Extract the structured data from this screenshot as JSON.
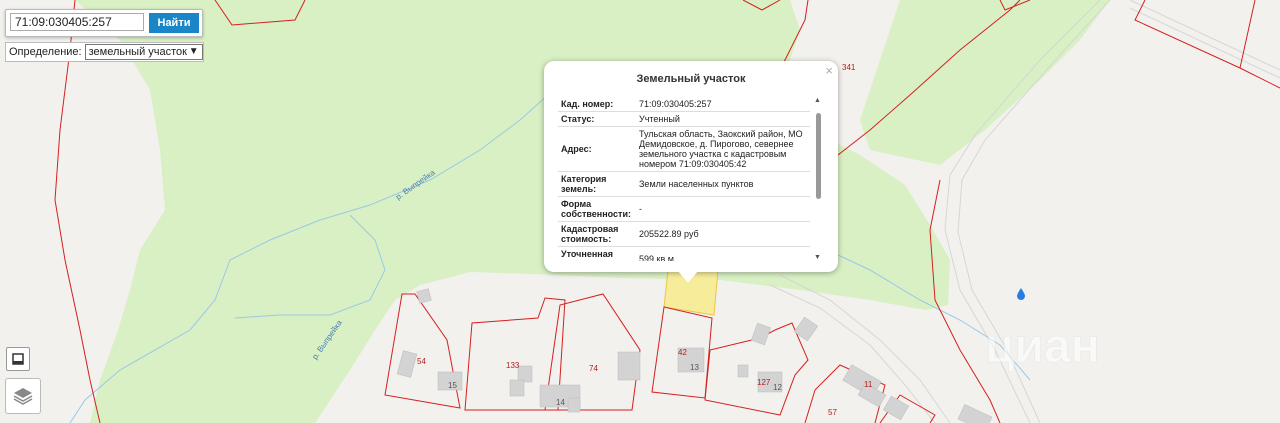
{
  "search": {
    "value": "71:09:030405:257",
    "button_label": "Найти"
  },
  "definition": {
    "label": "Определение:",
    "selected": "земельный участок"
  },
  "popup": {
    "title": "Земельный участок",
    "close_glyph": "×",
    "rows": [
      {
        "key": "Кад. номер:",
        "value": "71:09:030405:257"
      },
      {
        "key": "Статус:",
        "value": "Учтенный"
      },
      {
        "key": "Адрес:",
        "value": "Тульская область, Заокский район, МО Демидовское, д. Пирогово, севернее земельного участка с кадастровым номером 71:09:030405:42"
      },
      {
        "key": "Категория земель:",
        "value": "Земли населенных пунктов"
      },
      {
        "key": "Форма собственности:",
        "value": "-"
      },
      {
        "key": "Кадастровая стоимость:",
        "value": "205522.89 руб"
      },
      {
        "key": "Уточненная площадь:",
        "value": "599 кв.м"
      }
    ]
  },
  "map": {
    "river_label": "р. Выпрейка",
    "parcel_numbers": [
      "341",
      "54",
      "15",
      "133",
      "74",
      "14",
      "42",
      "13",
      "127",
      "12",
      "11",
      "57"
    ],
    "watermark": "циан"
  },
  "colors": {
    "forest": "#d8f0c4",
    "parcel_border": "#d42020",
    "selected_parcel": "#f7ec9a",
    "button": "#1a86c7",
    "water": "#2a7de0"
  }
}
